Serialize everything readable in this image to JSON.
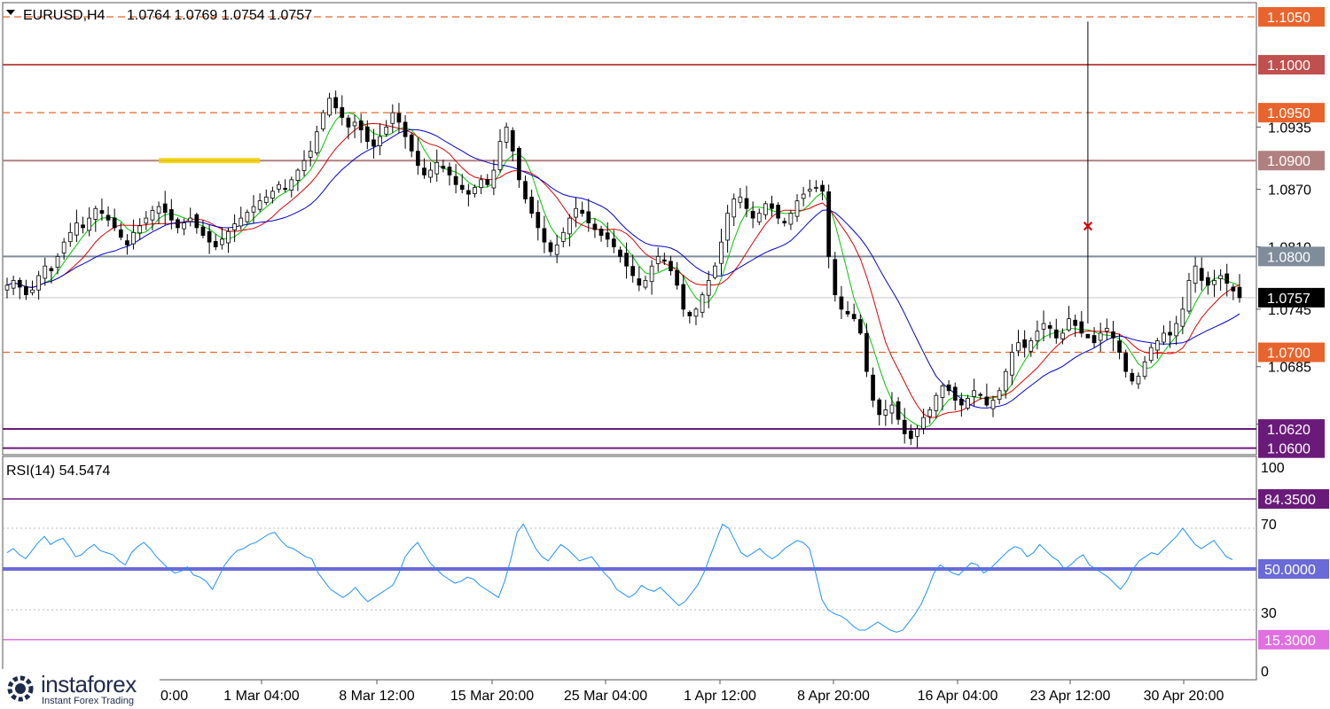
{
  "header": {
    "menu_icon": "triangle-down-icon",
    "symbol": "EURUSD,H4",
    "ohlc": "1.0764 1.0769 1.0754 1.0757"
  },
  "rsi_header": "RSI(14) 54.5474",
  "brand": {
    "name": "instaforex",
    "tagline": "Instant Forex Trading",
    "icon": "gear-logo-icon"
  },
  "colors": {
    "bull": "#000000",
    "bear": "#000000",
    "ma_fast": "#00c800",
    "ma_mid": "#e00000",
    "ma_slow": "#0000cc",
    "rsi_line": "#1e90ff",
    "rsi_mid": "#6a6ad8"
  },
  "chart_data": [
    {
      "type": "candlestick",
      "symbol": "EURUSD",
      "timeframe": "H4",
      "ylim": [
        1.0596,
        1.1062
      ],
      "price_ticks": [
        "1.0935",
        "1.0870",
        "1.0810",
        "1.0745",
        "1.0685",
        "1.0625"
      ],
      "x_labels": [
        "16 Feb 20:00",
        "22 Feb 20:00",
        "1 Mar 04:00",
        "8 Mar 12:00",
        "15 Mar 20:00",
        "25 Mar 04:00",
        "1 Apr 12:00",
        "8 Apr 20:00",
        "16 Apr 04:00",
        "23 Apr 12:00",
        "30 Apr 20:00"
      ],
      "levels": [
        {
          "value": 1.105,
          "label": "1.1050",
          "style": "dashed",
          "color": "#e8642c"
        },
        {
          "value": 1.1,
          "label": "1.1000",
          "style": "solid",
          "color": "#c0504d"
        },
        {
          "value": 1.095,
          "label": "1.0950",
          "style": "dashed",
          "color": "#e8642c"
        },
        {
          "value": 1.09,
          "label": "1.0900",
          "style": "solid",
          "color": "#b08080"
        },
        {
          "value": 1.08,
          "label": "1.0800",
          "style": "solid",
          "color": "#7f8c9a"
        },
        {
          "value": 1.0757,
          "label": "1.0757",
          "style": "current",
          "color": "#000000"
        },
        {
          "value": 1.07,
          "label": "1.0700",
          "style": "dashed",
          "color": "#e8642c"
        },
        {
          "value": 1.062,
          "label": "1.0620",
          "style": "solid",
          "color": "#6a1b7a"
        },
        {
          "value": 1.06,
          "label": "1.0600",
          "style": "solid",
          "color": "#6a1b7a"
        }
      ],
      "zone": {
        "value": 1.09,
        "from_index": 24,
        "to_index": 40,
        "color": "#f5d000"
      },
      "closes": [
        1.077,
        1.0775,
        1.0768,
        1.076,
        1.0765,
        1.078,
        1.079,
        1.0785,
        1.08,
        1.0815,
        1.0825,
        1.0835,
        1.083,
        1.084,
        1.085,
        1.0845,
        1.0838,
        1.083,
        1.082,
        1.0812,
        1.0825,
        1.0832,
        1.084,
        1.0848,
        1.0852,
        1.0846,
        1.0838,
        1.083,
        1.0835,
        1.084,
        1.083,
        1.0822,
        1.0815,
        1.081,
        1.0818,
        1.0826,
        1.0834,
        1.084,
        1.0846,
        1.0852,
        1.0858,
        1.0862,
        1.0868,
        1.0875,
        1.087,
        1.088,
        1.089,
        1.09,
        1.091,
        1.093,
        1.095,
        1.0965,
        1.0955,
        1.0945,
        1.0935,
        1.094,
        1.0932,
        1.092,
        1.0915,
        1.0925,
        1.0935,
        1.095,
        1.094,
        1.0925,
        1.091,
        1.0895,
        1.0885,
        1.089,
        1.0898,
        1.0892,
        1.0885,
        1.0875,
        1.087,
        1.0865,
        1.0872,
        1.088,
        1.0875,
        1.089,
        1.092,
        1.0935,
        1.091,
        1.088,
        1.086,
        1.0845,
        1.083,
        1.0815,
        1.0805,
        1.0812,
        1.0825,
        1.084,
        1.085,
        1.0845,
        1.0835,
        1.0828,
        1.0822,
        1.0818,
        1.081,
        1.08,
        1.079,
        1.078,
        1.077,
        1.0775,
        1.079,
        1.08,
        1.0795,
        1.0785,
        1.077,
        1.0745,
        1.0738,
        1.0745,
        1.076,
        1.0775,
        1.079,
        1.0815,
        1.0845,
        1.086,
        1.0862,
        1.085,
        1.084,
        1.0845,
        1.0855,
        1.085,
        1.084,
        1.0835,
        1.0845,
        1.0858,
        1.0865,
        1.087,
        1.0872,
        1.0868,
        1.08,
        1.076,
        1.0745,
        1.074,
        1.0735,
        1.072,
        1.068,
        1.065,
        1.0635,
        1.064,
        1.0645,
        1.063,
        1.0615,
        1.061,
        1.062,
        1.0632,
        1.064,
        1.0655,
        1.0665,
        1.066,
        1.065,
        1.0645,
        1.0652,
        1.066,
        1.0655,
        1.0645,
        1.065,
        1.066,
        1.068,
        1.07,
        1.071,
        1.0705,
        1.0712,
        1.0722,
        1.073,
        1.0725,
        1.0715,
        1.072,
        1.0735,
        1.0728,
        1.072,
        1.0715,
        1.071,
        1.072,
        1.0725,
        1.0715,
        1.07,
        1.068,
        1.067,
        1.0675,
        1.069,
        1.0705,
        1.0712,
        1.072,
        1.0718,
        1.073,
        1.0745,
        1.0775,
        1.079,
        1.0775,
        1.077,
        1.0775,
        1.078,
        1.0772,
        1.0764,
        1.0757
      ],
      "spike": {
        "index": 171,
        "high": 1.1045,
        "low": 1.073
      },
      "signal_marker": {
        "index": 171,
        "value": 1.0832,
        "symbol": "✕",
        "color": "#e00000"
      }
    },
    {
      "type": "line",
      "indicator": "RSI(14)",
      "ylim": [
        0,
        100
      ],
      "y_ticks": [
        "100",
        "70",
        "30",
        "0"
      ],
      "levels": [
        {
          "value": 84.35,
          "label": "84.3500",
          "color": "#6a1b7a"
        },
        {
          "value": 50.0,
          "label": "50.0000",
          "color": "#6a6ad8"
        },
        {
          "value": 15.3,
          "label": "15.3000",
          "color": "#e070e0"
        }
      ],
      "values": [
        58,
        60,
        57,
        55,
        59,
        63,
        66,
        62,
        64,
        65,
        61,
        56,
        57,
        60,
        62,
        59,
        58,
        57,
        54,
        52,
        58,
        61,
        63,
        60,
        56,
        53,
        50,
        48,
        49,
        51,
        47,
        46,
        44,
        40,
        46,
        52,
        56,
        59,
        60,
        62,
        63,
        65,
        67,
        68,
        64,
        61,
        60,
        58,
        56,
        55,
        48,
        44,
        40,
        38,
        36,
        38,
        41,
        37,
        34,
        36,
        38,
        40,
        42,
        48,
        56,
        60,
        63,
        58,
        53,
        50,
        47,
        45,
        43,
        44,
        46,
        45,
        42,
        40,
        38,
        36,
        44,
        55,
        68,
        72,
        66,
        60,
        56,
        54,
        58,
        62,
        60,
        57,
        54,
        55,
        56,
        52,
        48,
        45,
        40,
        38,
        36,
        38,
        42,
        40,
        39,
        41,
        38,
        35,
        32,
        34,
        38,
        42,
        48,
        56,
        64,
        72,
        70,
        64,
        58,
        56,
        58,
        60,
        57,
        55,
        57,
        60,
        62,
        64,
        63,
        60,
        48,
        35,
        30,
        28,
        27,
        25,
        22,
        20,
        20,
        22,
        24,
        22,
        20,
        19,
        20,
        24,
        28,
        33,
        40,
        48,
        52,
        50,
        48,
        47,
        50,
        53,
        52,
        48,
        50,
        53,
        56,
        59,
        61,
        60,
        56,
        58,
        62,
        59,
        56,
        54,
        50,
        52,
        55,
        57,
        52,
        50,
        48,
        46,
        43,
        40,
        44,
        50,
        54,
        56,
        58,
        57,
        60,
        63,
        66,
        70,
        66,
        62,
        60,
        62,
        64,
        60,
        56,
        54.5474
      ]
    }
  ]
}
